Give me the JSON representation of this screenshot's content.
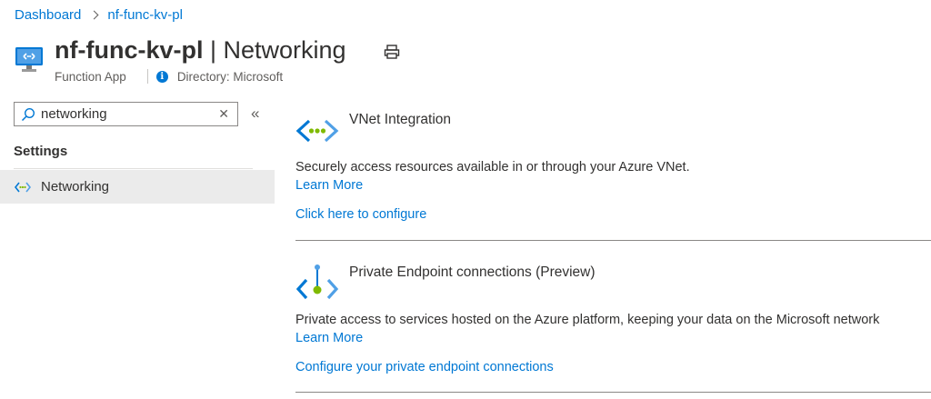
{
  "breadcrumb": {
    "items": [
      "Dashboard",
      "nf-func-kv-pl"
    ]
  },
  "header": {
    "resource_name": "nf-func-kv-pl",
    "page_name": "| Networking",
    "resource_type": "Function App",
    "directory": "Directory: Microsoft"
  },
  "sidebar": {
    "search_value": "networking",
    "section_title": "Settings",
    "items": [
      {
        "label": "Networking",
        "icon": "networking-icon",
        "selected": true
      }
    ]
  },
  "content": {
    "vnet": {
      "title": "VNet Integration",
      "description": "Securely access resources available in or through your Azure VNet.",
      "learn_more": "Learn More",
      "action": "Click here to configure"
    },
    "private_endpoint": {
      "title": "Private Endpoint connections (Preview)",
      "description": "Private access to services hosted on the Azure platform, keeping your data on the Microsoft network",
      "learn_more": "Learn More",
      "action": "Configure your private endpoint connections"
    }
  },
  "colors": {
    "link": "#0078d4",
    "accent_green": "#7fba00",
    "icon_blue": "#0078d4",
    "selected_bg": "#ebebeb"
  }
}
